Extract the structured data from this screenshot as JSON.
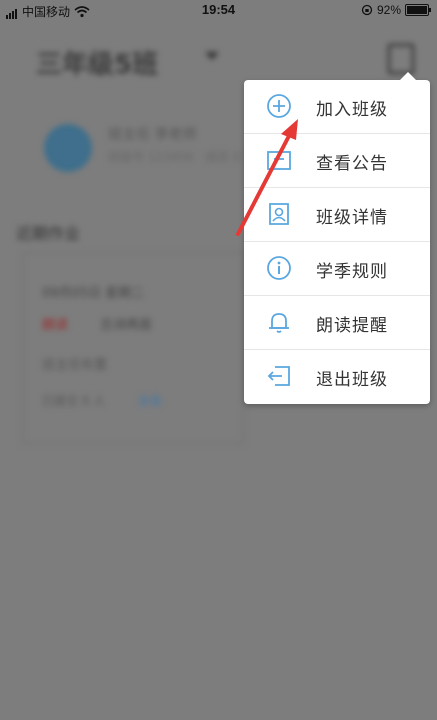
{
  "status_bar": {
    "carrier": "中国移动",
    "time": "19:54",
    "battery": "92%",
    "battery_level": 0.92
  },
  "background": {
    "class_title": "三年级5班",
    "teacher_name": "班主任 李老师",
    "teacher_sub": "班级号 123456 · 成员 0",
    "section_title": "近期作业",
    "card_line1": "09月05日 星期二",
    "card_tag": "朗读",
    "card_line2": "古诗两首",
    "card_line3": "班主任布置",
    "card_line4": "已提交 0 人",
    "card_link": "查看"
  },
  "menu": {
    "items": [
      {
        "label": "加入班级",
        "icon": "plus-circle-icon"
      },
      {
        "label": "查看公告",
        "icon": "notice-icon"
      },
      {
        "label": "班级详情",
        "icon": "class-detail-icon"
      },
      {
        "label": "学季规则",
        "icon": "info-icon"
      },
      {
        "label": "朗读提醒",
        "icon": "bell-icon"
      },
      {
        "label": "退出班级",
        "icon": "exit-icon"
      }
    ]
  },
  "colors": {
    "icon_blue": "#5aa7e0",
    "overlay": "#7d7d7d",
    "arrow_red": "#e53935"
  }
}
